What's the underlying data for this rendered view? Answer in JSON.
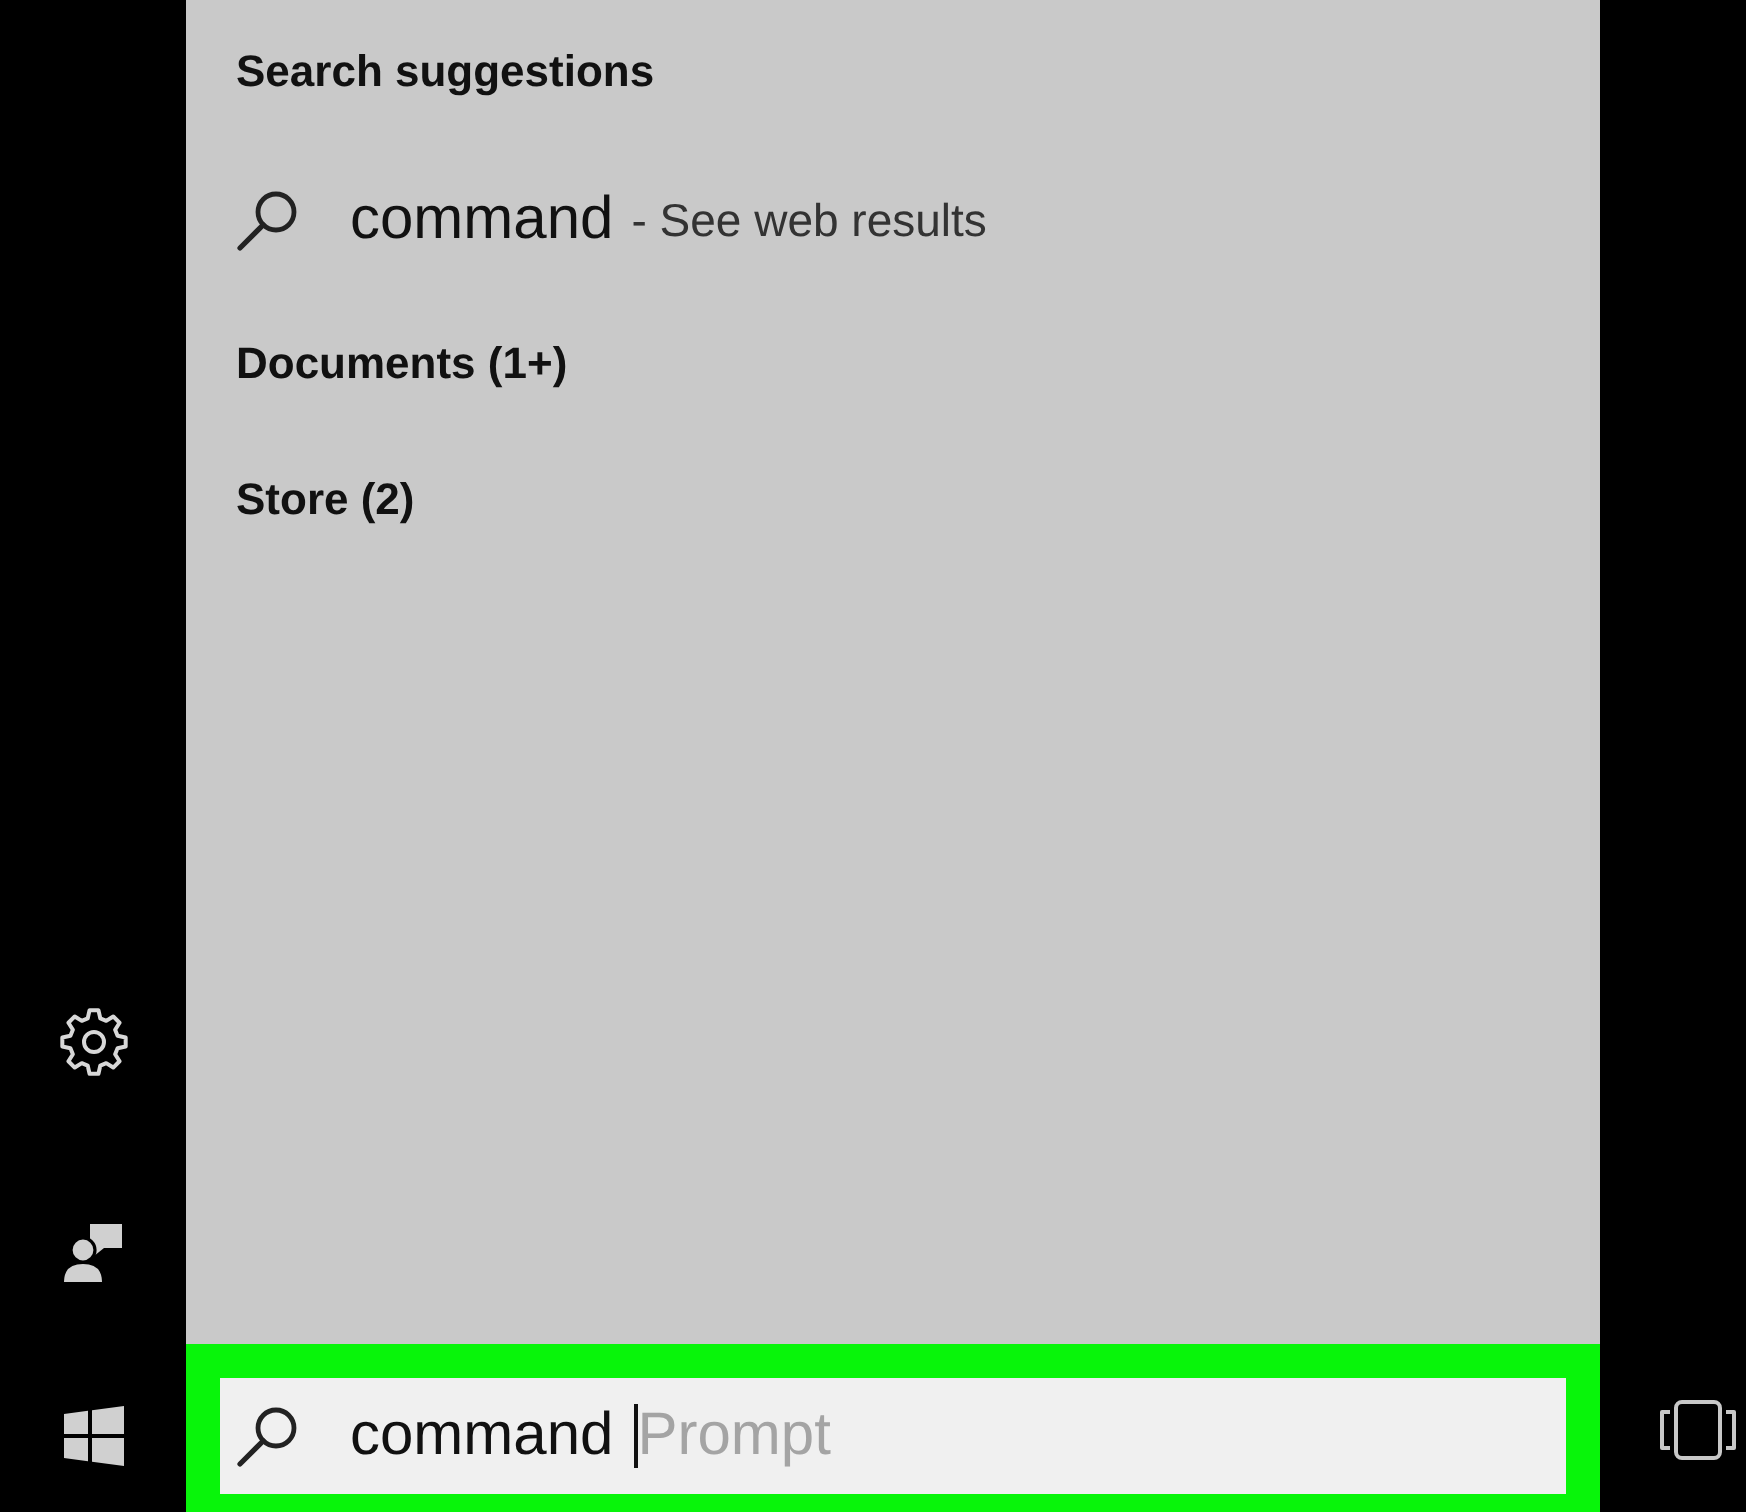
{
  "results": [
    {
      "kind": "heading",
      "label": "Search suggestions"
    },
    {
      "kind": "web",
      "query": "command",
      "hint": "- See web results"
    },
    {
      "kind": "category",
      "label": "Documents (1+)"
    },
    {
      "kind": "category",
      "label": "Store (2)"
    }
  ],
  "search_box": {
    "value": "command",
    "autocomplete": "Prompt",
    "focused": true,
    "highlighted": true
  }
}
